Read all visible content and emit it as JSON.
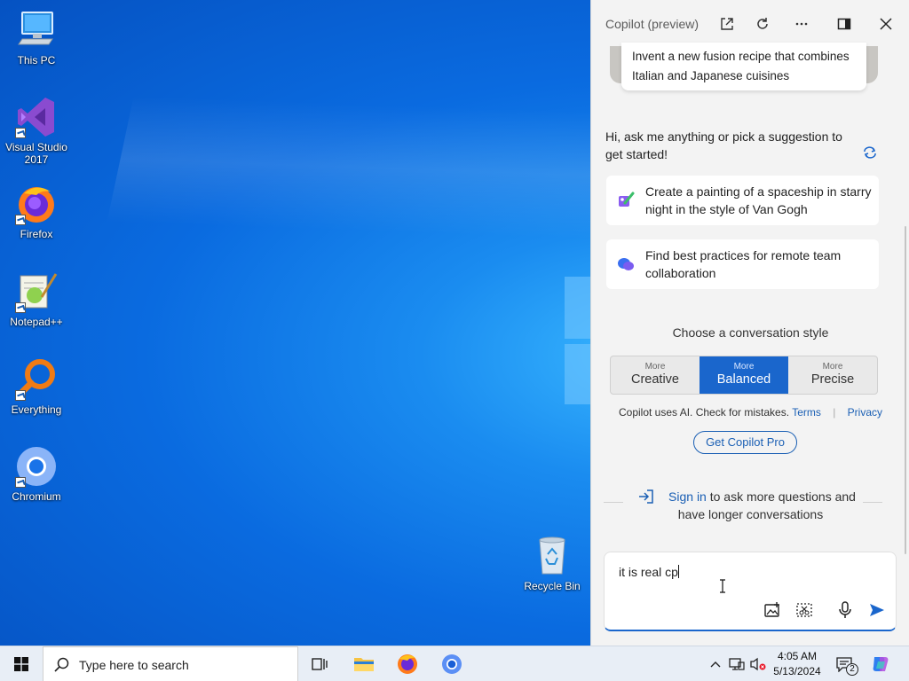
{
  "desktop": {
    "icons": [
      {
        "label": "This PC"
      },
      {
        "label": "Visual Studio\n2017"
      },
      {
        "label": "Firefox"
      },
      {
        "label": "Notepad++"
      },
      {
        "label": "Everything"
      },
      {
        "label": "Chromium"
      },
      {
        "label": "Recycle Bin"
      }
    ]
  },
  "copilot": {
    "title": "Copilot (preview)",
    "header_icons": [
      "open-external-icon",
      "refresh-icon",
      "more-icon",
      "dock-icon",
      "close-icon"
    ],
    "top_card": "Invent a new fusion recipe that combines Italian and Japanese cuisines",
    "greeting": "Hi, ask me anything or pick a suggestion to get started!",
    "suggestions": [
      {
        "text": "Create a painting of a spaceship in starry night in the style of Van Gogh",
        "icon": "paint-icon"
      },
      {
        "text": "Find best practices for remote team collaboration",
        "icon": "chat-bubbles-icon"
      }
    ],
    "style_label": "Choose a conversation style",
    "styles": [
      {
        "small": "More",
        "large": "Creative",
        "active": false
      },
      {
        "small": "More",
        "large": "Balanced",
        "active": true
      },
      {
        "small": "More",
        "large": "Precise",
        "active": false
      }
    ],
    "disclaimer": {
      "text": "Copilot uses AI. Check for mistakes.",
      "terms": "Terms",
      "privacy": "Privacy"
    },
    "pro_button": "Get Copilot Pro",
    "signin": {
      "link": "Sign in",
      "text": " to ask more questions and have longer conversations"
    },
    "composer": {
      "value": "it is real cp"
    },
    "accent": "#1a66cc"
  },
  "taskbar": {
    "search_placeholder": "Type here to search",
    "time": "4:05 AM",
    "date": "5/13/2024",
    "notification_count": "2"
  }
}
